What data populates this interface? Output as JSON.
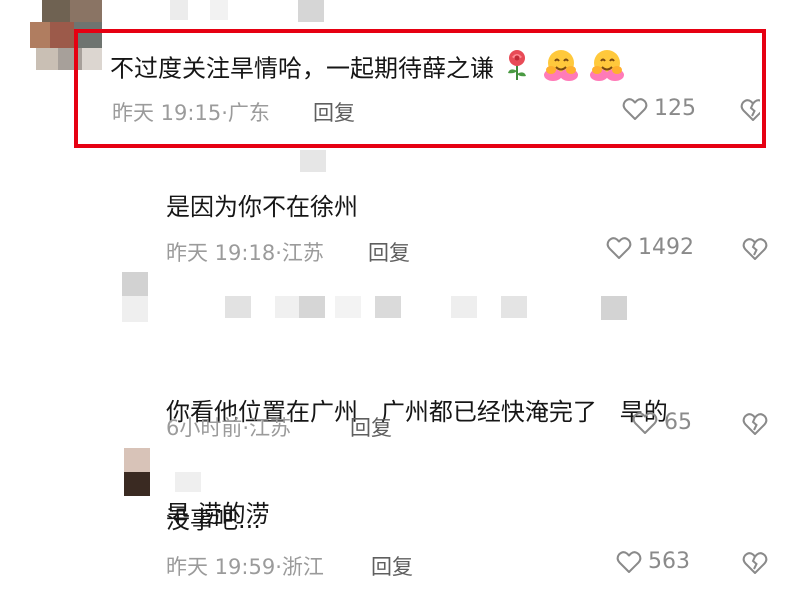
{
  "comments": [
    {
      "text": "不过度关注旱情哈，一起期待薛之谦",
      "emojis": [
        "rose",
        "hug",
        "hug"
      ],
      "time": "昨天 19:15",
      "location": "广东",
      "reply_label": "回复",
      "likes": "125",
      "highlighted": true
    },
    {
      "text": "是因为你不在徐州",
      "time": "昨天 19:18",
      "location": "江苏",
      "reply_label": "回复",
      "likes": "1492"
    },
    {
      "text_line1": "你看他位置在广州   广州都已经快淹完了   旱的",
      "text_line2": "旱 涝的涝",
      "time": "6小时前",
      "location": "江苏",
      "reply_label": "回复",
      "likes": "65"
    },
    {
      "text": "没事吧...",
      "time": "昨天 19:59",
      "location": "浙江",
      "reply_label": "回复",
      "likes": "563"
    }
  ],
  "meta_separator": "·",
  "colors": {
    "highlight_border": "#e60012",
    "text": "#161616",
    "meta": "#9b9b9b"
  }
}
